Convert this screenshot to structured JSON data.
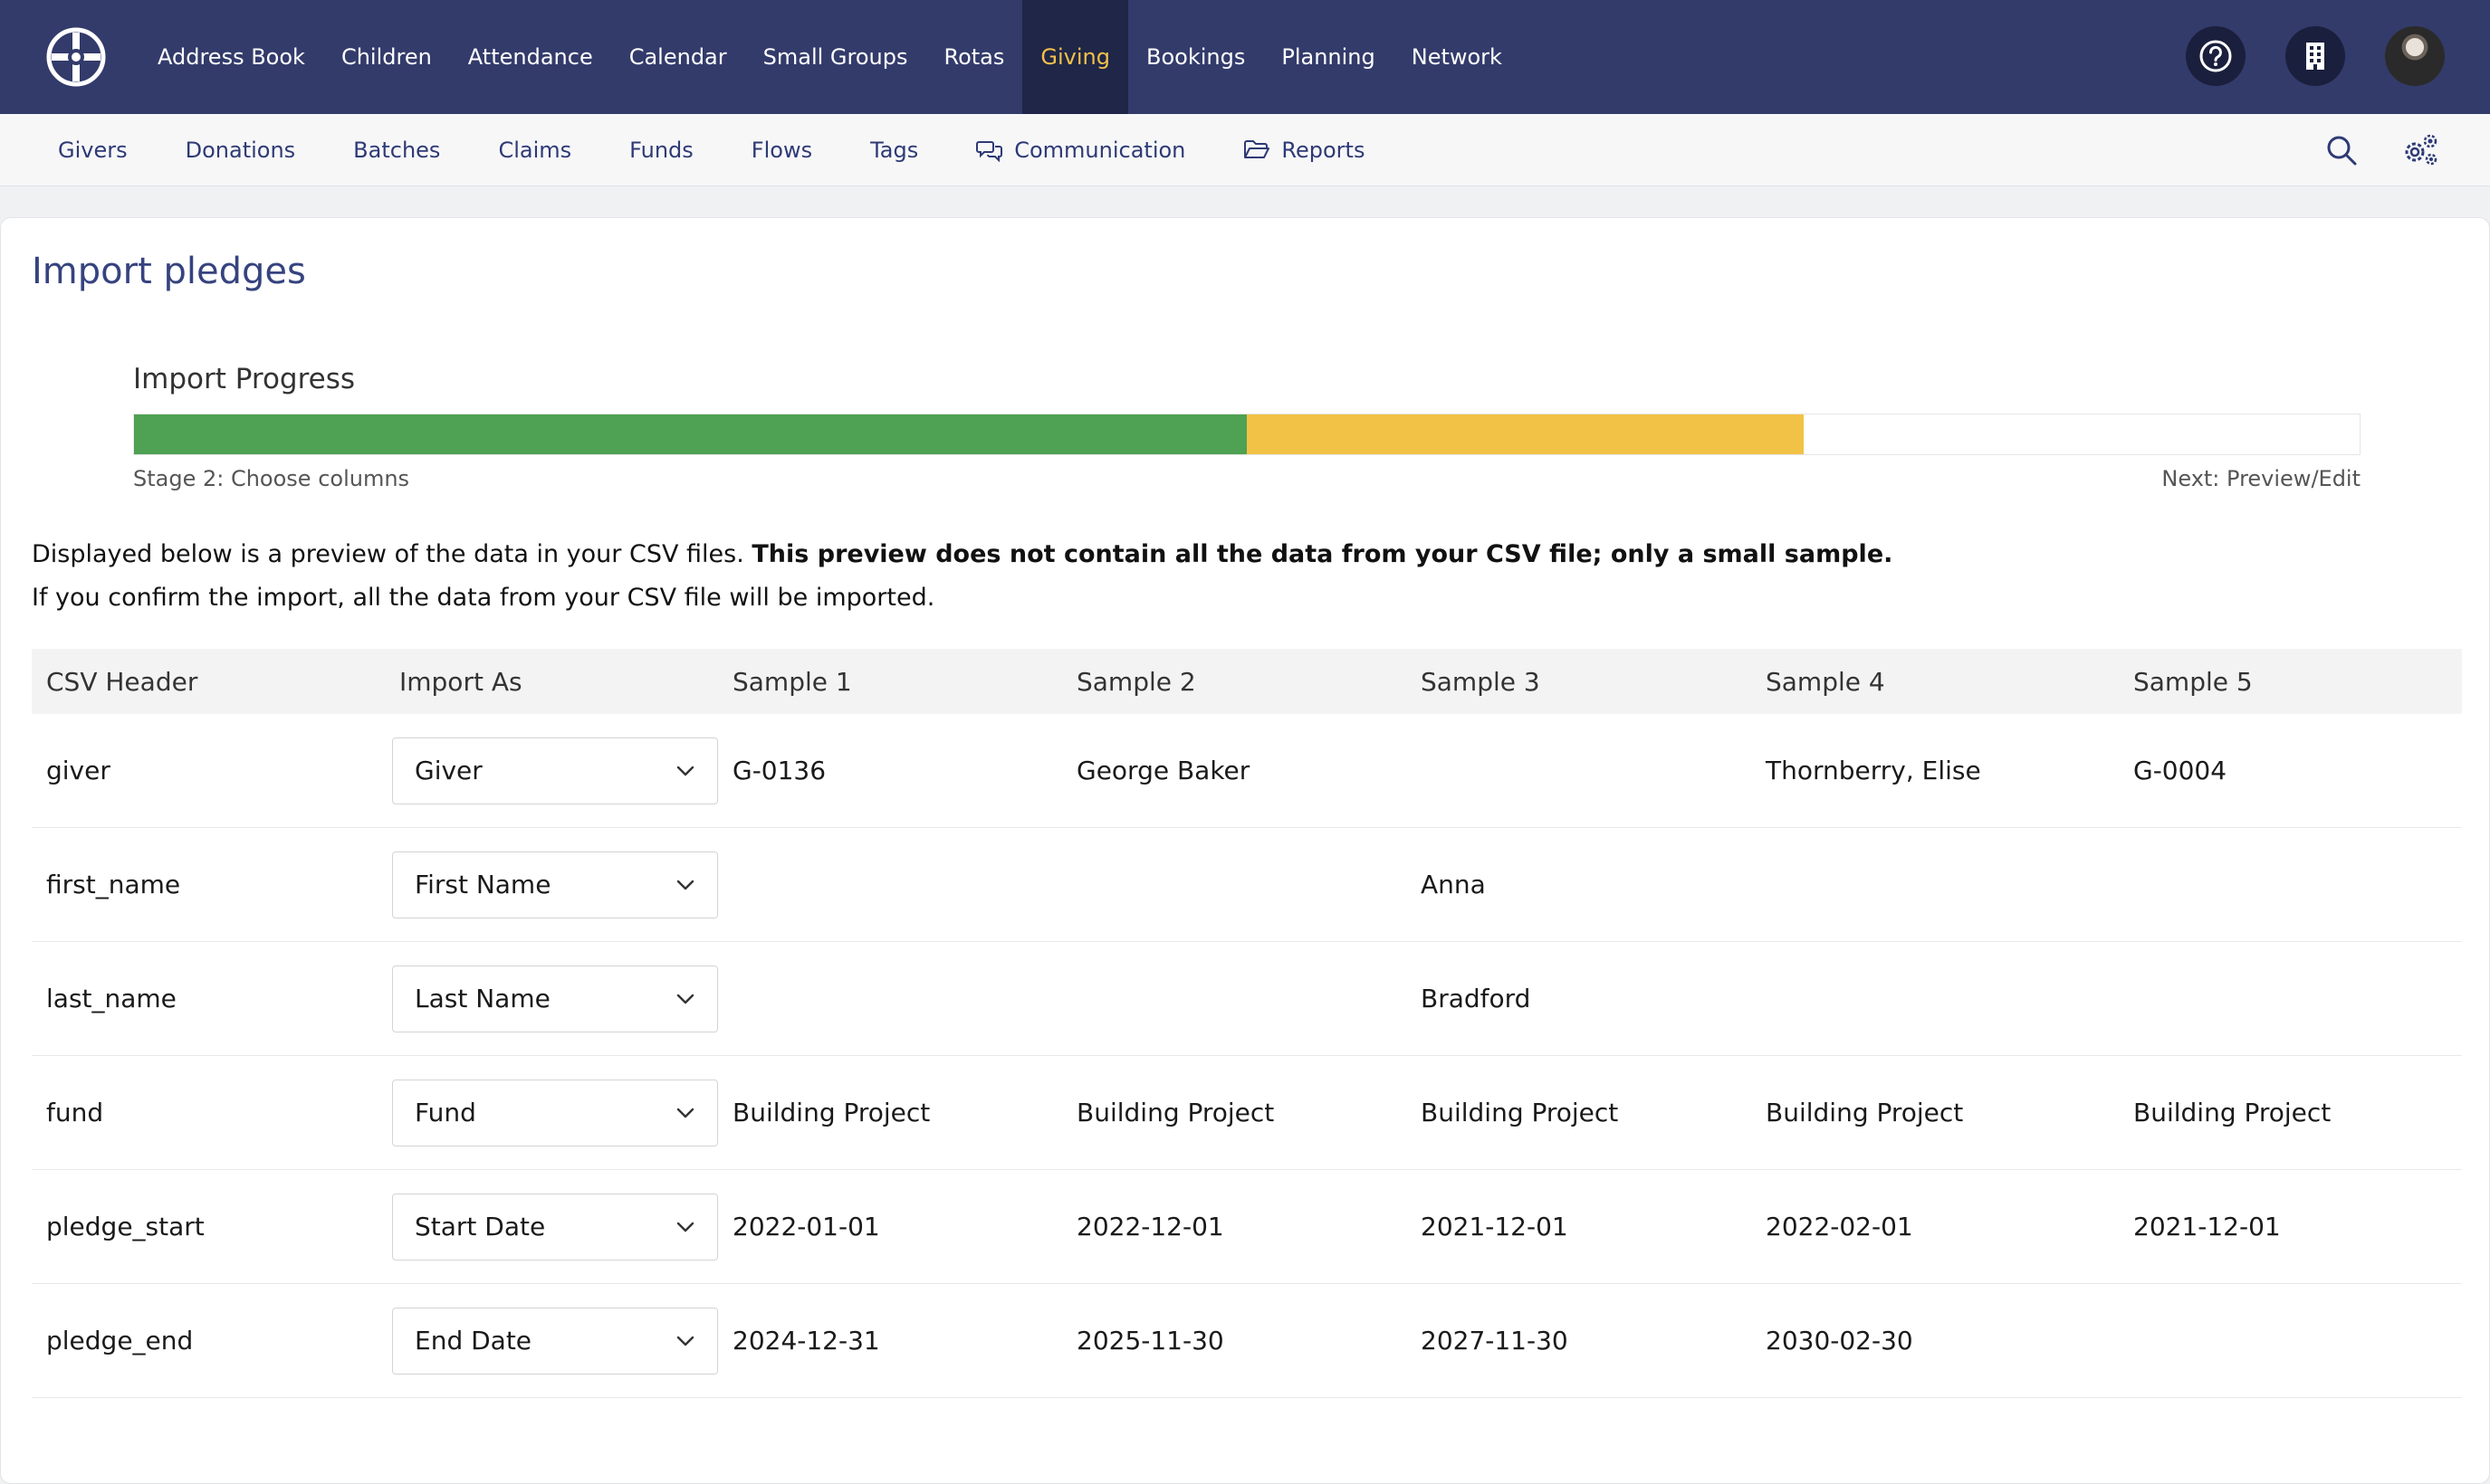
{
  "topnav": {
    "items": [
      {
        "label": "Address Book"
      },
      {
        "label": "Children"
      },
      {
        "label": "Attendance"
      },
      {
        "label": "Calendar"
      },
      {
        "label": "Small Groups"
      },
      {
        "label": "Rotas"
      },
      {
        "label": "Giving"
      },
      {
        "label": "Bookings"
      },
      {
        "label": "Planning"
      },
      {
        "label": "Network"
      }
    ],
    "active": "Giving",
    "active_color": "#f2c14a",
    "background": "#333b6b"
  },
  "subnav": {
    "items": [
      {
        "label": "Givers"
      },
      {
        "label": "Donations"
      },
      {
        "label": "Batches"
      },
      {
        "label": "Claims"
      },
      {
        "label": "Funds"
      },
      {
        "label": "Flows"
      },
      {
        "label": "Tags"
      },
      {
        "label": "Communication",
        "icon": "chat-icon"
      },
      {
        "label": "Reports",
        "icon": "folder-icon"
      }
    ]
  },
  "page": {
    "title": "Import pledges",
    "progress": {
      "label": "Import Progress",
      "completed_fraction": 0.5,
      "current_fraction": 0.25,
      "stage": "Stage 2: Choose columns",
      "next": "Next: Preview/Edit"
    },
    "intro": {
      "line1_plain": "Displayed below is a preview of the data in your CSV files. ",
      "line1_bold": "This preview does not contain all the data from your CSV file; only a small sample.",
      "line2": "If you confirm the import, all the data from your CSV file will be imported."
    }
  },
  "table": {
    "headers": [
      "CSV Header",
      "Import As",
      "Sample 1",
      "Sample 2",
      "Sample 3",
      "Sample 4",
      "Sample 5"
    ],
    "rows": [
      {
        "header": "giver",
        "import_as": "Giver",
        "samples": [
          "G-0136",
          "George Baker",
          "",
          "Thornberry, Elise",
          "G-0004"
        ]
      },
      {
        "header": "first_name",
        "import_as": "First Name",
        "samples": [
          "",
          "",
          "Anna",
          "",
          ""
        ]
      },
      {
        "header": "last_name",
        "import_as": "Last Name",
        "samples": [
          "",
          "",
          "Bradford",
          "",
          ""
        ]
      },
      {
        "header": "fund",
        "import_as": "Fund",
        "samples": [
          "Building Project",
          "Building Project",
          "Building Project",
          "Building Project",
          "Building Project"
        ]
      },
      {
        "header": "pledge_start",
        "import_as": "Start Date",
        "samples": [
          "2022-01-01",
          "2022-12-01",
          "2021-12-01",
          "2022-02-01",
          "2021-12-01"
        ]
      },
      {
        "header": "pledge_end",
        "import_as": "End Date",
        "samples": [
          "2024-12-31",
          "2025-11-30",
          "2027-11-30",
          "2030-02-30",
          ""
        ]
      }
    ]
  }
}
